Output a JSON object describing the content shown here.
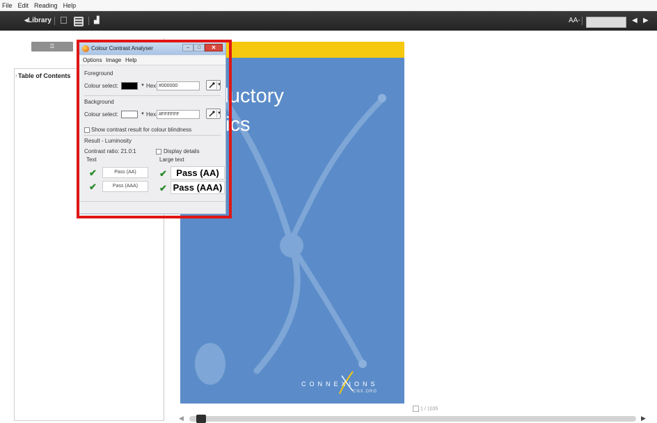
{
  "menubar": {
    "items": [
      "File",
      "Edit",
      "Reading",
      "Help"
    ]
  },
  "toolbar": {
    "library": "◂Library",
    "font_size": "AA-"
  },
  "left_panel": {
    "view_toggle": "☰",
    "toc_label": "Table of Contents",
    "toc_expand": "›"
  },
  "cover": {
    "title_line1": "roductory",
    "title_line2": "tistics",
    "publisher": "CONNEXIONS",
    "publisher_sub": "CNX.ORG",
    "band_color": "#f6c90e",
    "background_color": "#5b8cc9"
  },
  "footer": {
    "page_indicator": "1 / 1035",
    "progress": 0.01
  },
  "dialog": {
    "title": "Colour Contrast Analyser",
    "close_glyph": "✕",
    "minimize_glyph": "–",
    "maximize_glyph": "□",
    "menu": [
      "Options",
      "Image",
      "Help"
    ],
    "foreground": {
      "heading": "Foreground",
      "colour_label": "Colour select:",
      "hex_label": "Hex:",
      "hex_value": "#000000",
      "swatch_color": "#000000"
    },
    "background": {
      "heading": "Background",
      "colour_label": "Colour select:",
      "hex_label": "Hex:",
      "hex_value": "#FFFFFF",
      "swatch_color": "#FFFFFF"
    },
    "colour_blindness_label": "Show contrast result for colour blindness",
    "result_heading": "Result - Luminosity",
    "contrast_ratio": "Contrast ratio: 21.0:1",
    "display_details_label": "Display details",
    "text_header": "Text",
    "large_text_header": "Large text",
    "text_aa": "Pass (AA)",
    "text_aaa": "Pass (AAA)",
    "large_aa": "Pass (AA)",
    "large_aaa": "Pass (AAA)",
    "check_glyph": "✔",
    "highlight_color": "#e01616"
  }
}
